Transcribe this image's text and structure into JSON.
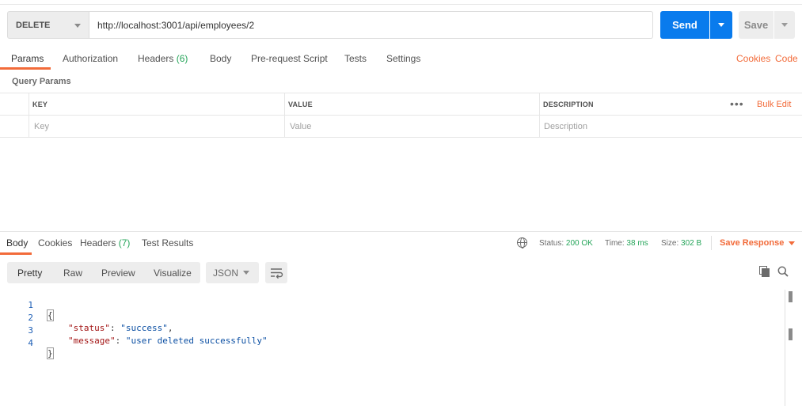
{
  "request": {
    "method": "DELETE",
    "url": "http://localhost:3001/api/employees/2",
    "send_label": "Send",
    "save_label": "Save"
  },
  "request_tabs": {
    "params": "Params",
    "authorization": "Authorization",
    "headers": "Headers",
    "headers_count": "(6)",
    "body": "Body",
    "prerequest": "Pre-request Script",
    "tests": "Tests",
    "settings": "Settings",
    "cookies": "Cookies",
    "code": "Code"
  },
  "query_params": {
    "title": "Query Params",
    "columns": {
      "key": "KEY",
      "value": "VALUE",
      "description": "DESCRIPTION"
    },
    "placeholders": {
      "key": "Key",
      "value": "Value",
      "description": "Description"
    },
    "bulk_edit": "Bulk Edit"
  },
  "response": {
    "tabs": {
      "body": "Body",
      "cookies": "Cookies",
      "headers": "Headers",
      "headers_count": "(7)",
      "test_results": "Test Results"
    },
    "status_label": "Status:",
    "status_value": "200 OK",
    "time_label": "Time:",
    "time_value": "38 ms",
    "size_label": "Size:",
    "size_value": "302 B",
    "save_response": "Save Response",
    "view_modes": {
      "pretty": "Pretty",
      "raw": "Raw",
      "preview": "Preview",
      "visualize": "Visualize"
    },
    "format": "JSON",
    "code_lines": {
      "l1": {
        "num": "1",
        "text": "{"
      },
      "l2": {
        "num": "2",
        "key": "\"status\"",
        "sep": ": ",
        "value": "\"success\"",
        "end": ","
      },
      "l3": {
        "num": "3",
        "key": "\"message\"",
        "sep": ": ",
        "value": "\"user deleted successfully\"",
        "end": ""
      },
      "l4": {
        "num": "4",
        "text": "}"
      }
    }
  },
  "colors": {
    "accent": "#f26b3a",
    "primary": "#097bed",
    "success": "#26a55a"
  },
  "icons": [
    "caret-down-icon",
    "more-dots-icon",
    "globe-icon",
    "wrap-lines-icon",
    "copy-icon",
    "search-icon"
  ]
}
